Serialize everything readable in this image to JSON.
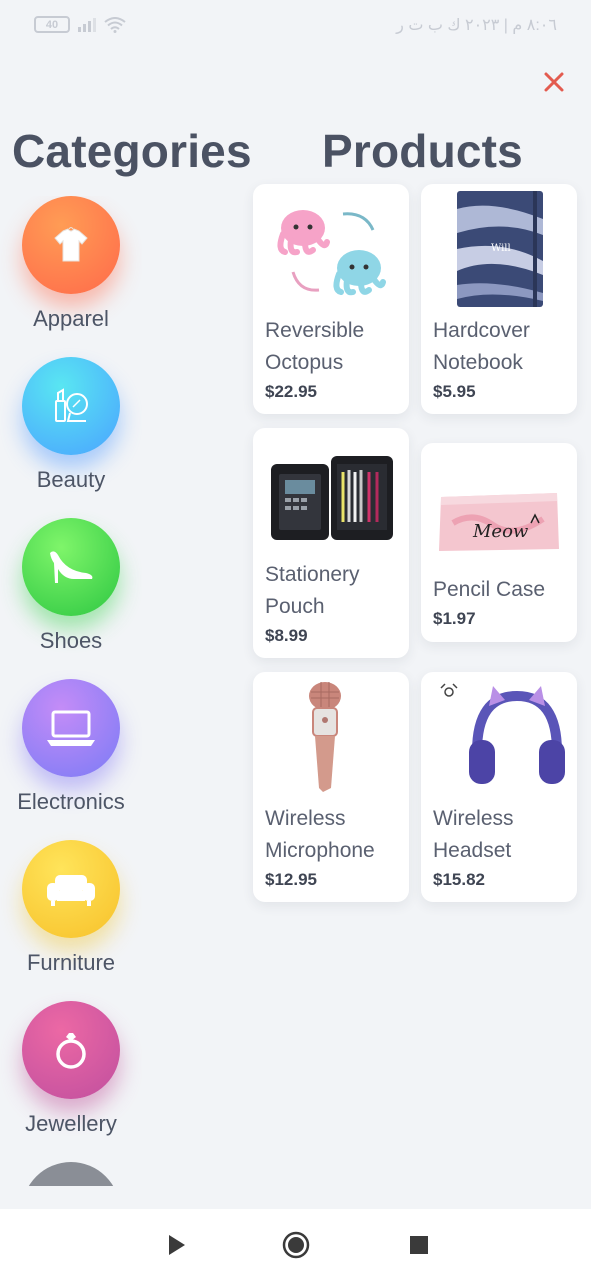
{
  "status_bar": {
    "battery": "40",
    "time_text": "٨:٠٦ م | ٢٠٢٣ ك ب ت ر"
  },
  "header": {
    "categories_title": "Categories",
    "products_title": "Products",
    "close_icon": "close-icon"
  },
  "categories": [
    {
      "label": "Apparel",
      "icon": "tshirt-icon",
      "color": "#ff7a4d"
    },
    {
      "label": "Beauty",
      "icon": "lipstick-mirror-icon",
      "color": "#4aa3ff"
    },
    {
      "label": "Shoes",
      "icon": "high-heel-icon",
      "color": "#2dc742"
    },
    {
      "label": "Electronics",
      "icon": "laptop-icon",
      "color": "#8a7bf6"
    },
    {
      "label": "Furniture",
      "icon": "sofa-icon",
      "color": "#f7c12a"
    },
    {
      "label": "Jewellery",
      "icon": "ring-icon",
      "color": "#c04f9f"
    }
  ],
  "products": [
    {
      "name_line1": "Reversible",
      "name_line2": "Octopus",
      "price": "$22.95",
      "image": "octopus-plush-image"
    },
    {
      "name_line1": "Hardcover",
      "name_line2": "Notebook",
      "price": "$5.95",
      "image": "notebook-image"
    },
    {
      "name_line1": "Stationery",
      "name_line2": "Pouch",
      "price": "$8.99",
      "image": "stationery-pouch-image"
    },
    {
      "name_line1": "Pencil Case",
      "name_line2": "",
      "price": "$1.97",
      "image": "pencil-case-image"
    },
    {
      "name_line1": "Wireless",
      "name_line2": "Microphone",
      "price": "$12.95",
      "image": "microphone-image"
    },
    {
      "name_line1": "Wireless",
      "name_line2": "Headset",
      "price": "$15.82",
      "image": "headset-image"
    }
  ],
  "nav": {
    "back": "back-triangle-icon",
    "home": "home-circle-icon",
    "recents": "recents-square-icon"
  },
  "colors": {
    "background": "#f2f4f7",
    "title": "#4b5263",
    "close": "#e35b4f"
  }
}
